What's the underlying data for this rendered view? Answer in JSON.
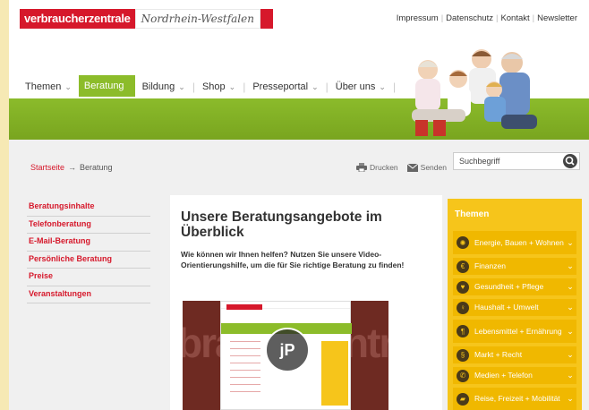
{
  "header": {
    "logo_main": "verbraucherzentrale",
    "logo_region": "Nordrhein-Westfalen"
  },
  "meta_nav": [
    "Impressum",
    "Datenschutz",
    "Kontakt",
    "Newsletter"
  ],
  "main_nav": [
    {
      "label": "Themen",
      "dropdown": true
    },
    {
      "label": "Beratung",
      "dropdown": false,
      "active": true
    },
    {
      "label": "Bildung",
      "dropdown": true
    },
    {
      "label": "Shop",
      "dropdown": true
    },
    {
      "label": "Presseportal",
      "dropdown": true
    },
    {
      "label": "Über uns",
      "dropdown": true
    }
  ],
  "breadcrumb": {
    "home": "Startseite",
    "sep": "→",
    "current": "Beratung"
  },
  "tools": {
    "print": "Drucken",
    "send": "Senden"
  },
  "search": {
    "placeholder": "Suchbegriff"
  },
  "subnav": [
    "Beratungsinhalte",
    "Telefonberatung",
    "E-Mail-Beratung",
    "Persönliche Beratung",
    "Preise",
    "Veranstaltungen"
  ],
  "main": {
    "headline": "Unsere Beratungsangebote im Überblick",
    "intro": "Wie können wir Ihnen helfen? Nutzen Sie unsere Video-Orientierungshilfe, um die für Sie richtige Beratung zu finden!",
    "video_play_label": "jP",
    "video_bg_word_left": "bra",
    "video_bg_word_right": "ntra"
  },
  "sidebar": {
    "title": "Themen",
    "topics": [
      {
        "label": "Energie, Bauen + Wohnen",
        "icon": "energy-icon"
      },
      {
        "label": "Finanzen",
        "icon": "finance-icon"
      },
      {
        "label": "Gesundheit + Pflege",
        "icon": "health-icon"
      },
      {
        "label": "Haushalt + Umwelt",
        "icon": "household-icon"
      },
      {
        "label": "Lebensmittel + Ernährung",
        "icon": "food-icon"
      },
      {
        "label": "Markt + Recht",
        "icon": "market-icon"
      },
      {
        "label": "Medien + Telefon",
        "icon": "media-icon"
      },
      {
        "label": "Reise, Freizeit + Mobilität",
        "icon": "travel-icon"
      }
    ]
  },
  "colors": {
    "brand_red": "#d6182b",
    "nav_green": "#8cbc2a",
    "sidebar_yellow": "#f6c51b"
  }
}
